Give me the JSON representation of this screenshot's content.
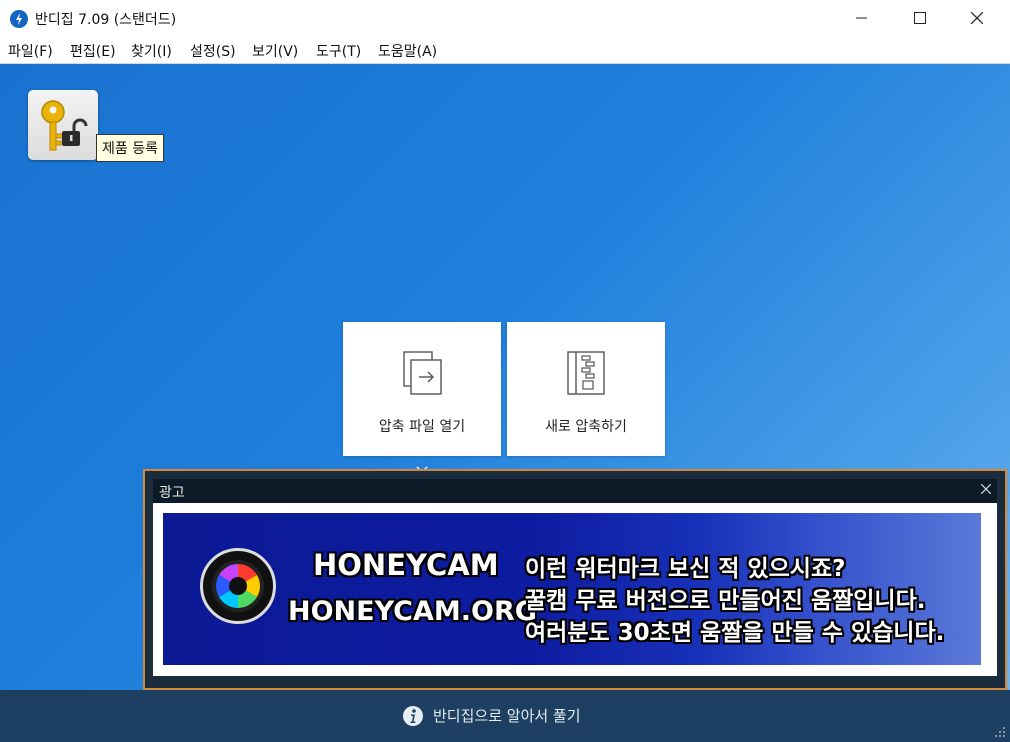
{
  "window": {
    "title": "반디집 7.09 (스탠더드)",
    "controls": [
      "minimize-icon",
      "maximize-icon",
      "close-icon"
    ]
  },
  "menu": [
    {
      "label": "파일(F)"
    },
    {
      "label": "편집(E)"
    },
    {
      "label": "찾기(I)"
    },
    {
      "label": "설정(S)"
    },
    {
      "label": "보기(V)"
    },
    {
      "label": "도구(T)"
    },
    {
      "label": "도움말(A)"
    }
  ],
  "registration": {
    "icon": "key-lock-icon",
    "tooltip": "제품 등록"
  },
  "actions": [
    {
      "label": "압축 파일 열기",
      "icon": "open-archive-icon"
    },
    {
      "label": "새로 압축하기",
      "icon": "new-archive-icon"
    }
  ],
  "ad": {
    "title": "광고",
    "brand": "HONEYCAM",
    "url": "HONEYCAM.ORG",
    "lines": [
      "이런 워터마크 보신 적 있으시죠?",
      "꿀캠 무료 버전으로 만들어진 움짤입니다.",
      "여러분도 30초면 움짤을 만들 수 있습니다."
    ]
  },
  "status": {
    "icon": "info-icon",
    "text": "반디집으로 알아서 풀기"
  },
  "colors": {
    "accent": "#1f7fdc",
    "status_bar": "#1d3f61",
    "ad_border": "#d2883a"
  }
}
